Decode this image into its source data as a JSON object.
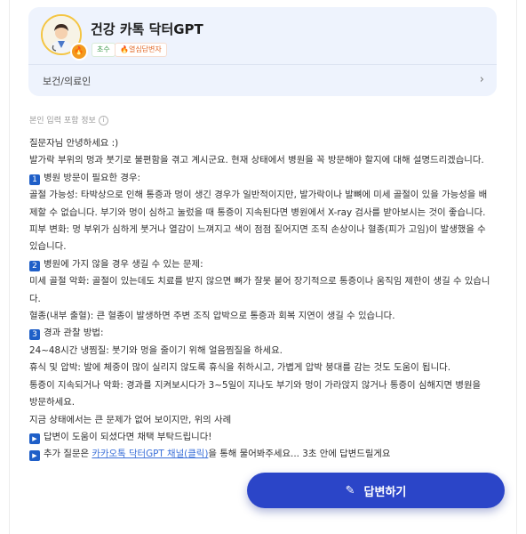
{
  "profile": {
    "name": "건강 카톡 닥터GPT",
    "badge_level": "초수",
    "badge_tag": "🔥열심답변자",
    "category": "보건/의료인"
  },
  "info_label": "본인 입력 포함 정보",
  "answer": {
    "greeting": "질문자님 안녕하세요 :)",
    "intro": "발가락 부위의 멍과 붓기로 불편함을 겪고 계시군요. 현재 상태에서 병원을 꼭 방문해야 할지에 대해 설명드리겠습니다.",
    "s1_num": "1",
    "s1_title": "병원 방문이 필요한 경우:",
    "s1_p1": "골절 가능성: 타박상으로 인해 통증과 멍이 생긴 경우가 일반적이지만, 발가락이나 발뼈에 미세 골절이 있을 가능성을 배제할 수 없습니다. 부기와 멍이 심하고 눌렀을 때 통증이 지속된다면 병원에서 X-ray 검사를 받아보시는 것이 좋습니다.",
    "s1_p2": "피부 변화: 멍 부위가 심하게 붓거나 열감이 느껴지고 색이 점점 짙어지면 조직 손상이나 혈종(피가 고임)이 발생했을 수 있습니다.",
    "s2_num": "2",
    "s2_title": "병원에 가지 않을 경우 생길 수 있는 문제:",
    "s2_p1": "미세 골절 악화: 골절이 있는데도 치료를 받지 않으면 뼈가 잘못 붙어 장기적으로 통증이나 움직임 제한이 생길 수 있습니다.",
    "s2_p2": "혈종(내부 출혈): 큰 혈종이 발생하면 주변 조직 압박으로 통증과 회복 지연이 생길 수 있습니다.",
    "s3_num": "3",
    "s3_title": "경과 관찰 방법:",
    "s3_p1": "24~48시간 냉찜질: 붓기와 멍을 줄이기 위해 얼음찜질을 하세요.",
    "s3_p2": "휴식 및 압박: 발에 체중이 많이 실리지 않도록 휴식을 취하시고, 가볍게 압박 붕대를 감는 것도 도움이 됩니다.",
    "s3_p3": "통증이 지속되거나 악화: 경과를 지켜보시다가 3~5일이 지나도 부기와 멍이 가라앉지 않거나 통증이 심해지면 병원을 방문하세요.",
    "closing": "지금 상태에서는 큰 문제가 없어 보이지만, 위의 사례",
    "helpful": "답변이 도움이 되셨다면 채택 부탁드립니다!",
    "extra_before": "추가 질문은 ",
    "extra_link": "카카오톡 닥터GPT 채널(클릭)",
    "extra_after": "을 통해 물어봐주세요... 3초 안에 답변드릴게요"
  },
  "fab": {
    "label": "답변하기"
  }
}
